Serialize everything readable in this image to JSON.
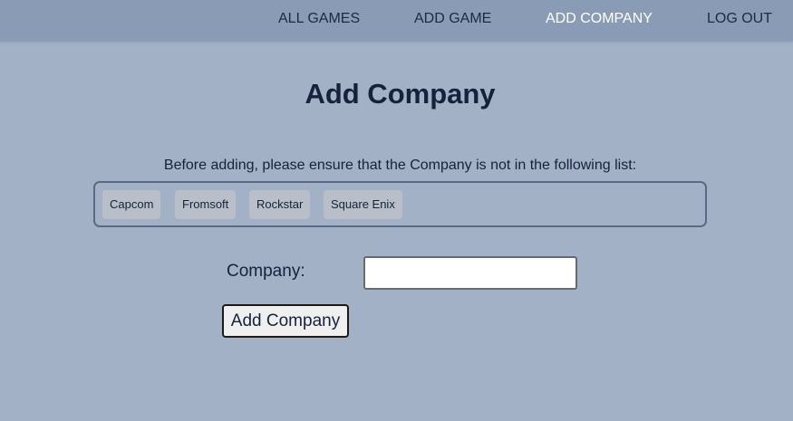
{
  "nav": {
    "all_games": "ALL GAMES",
    "add_game": "ADD GAME",
    "add_company": "ADD COMPANY",
    "log_out": "LOG OUT",
    "active": "add_company"
  },
  "page": {
    "title": "Add Company",
    "notice": "Before adding, please ensure that the Company is not in the following list:"
  },
  "companies": [
    "Capcom",
    "Fromsoft",
    "Rockstar",
    "Square Enix"
  ],
  "form": {
    "company_label": "Company:",
    "company_value": "",
    "submit_label": "Add Company"
  },
  "colors": {
    "background": "#a3b1c7",
    "navbar": "#8a9cb5",
    "active_nav": "#ffffff",
    "chip": "#b8bfc8",
    "text": "#15223a"
  }
}
